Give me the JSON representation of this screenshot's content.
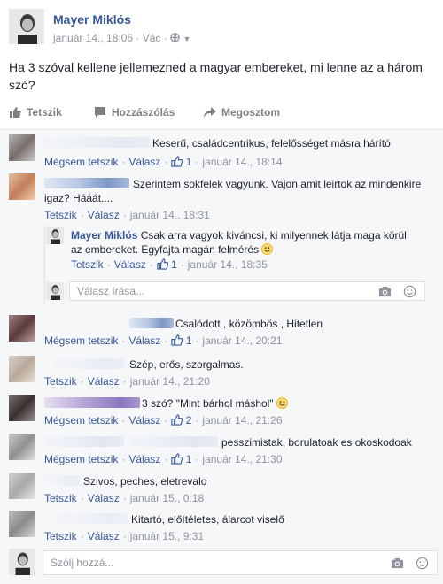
{
  "post": {
    "author": "Mayer Miklós",
    "date": "január 14., 18:06",
    "location": "Vác",
    "text": "Ha 3 szóval kellene jellemezned a magyar embereket, mi lenne az a három szó?",
    "actions": {
      "like": "Tetszik",
      "comment": "Hozzászólás",
      "share": "Megosztom"
    }
  },
  "comments": [
    {
      "text": "Keserű, családcentrikus, felelősséget másra hárító",
      "like": "Mégsem tetszik",
      "reply": "Válasz",
      "likes": "1",
      "time": "január 14., 18:14"
    },
    {
      "text": "Szerintem sokfelek vagyunk. Vajon amit leirtok az mindenkire",
      "text2": "igaz? Hááát....",
      "like": "Tetszik",
      "reply": "Válasz",
      "likes": "",
      "time": "január 14., 18:31"
    },
    {
      "text": "Csalódott , közömbös , Hitetlen",
      "like": "Mégsem tetszik",
      "reply": "Válasz",
      "likes": "1",
      "time": "január 14., 20:21"
    },
    {
      "text": "Szép, erős, szorgalmas.",
      "like": "Tetszik",
      "reply": "Válasz",
      "likes": "",
      "time": "január 14., 21:20"
    },
    {
      "text": "3 szó? \"Mint bárhol máshol\"",
      "like": "Mégsem tetszik",
      "reply": "Válasz",
      "likes": "2",
      "time": "január 14., 21:26"
    },
    {
      "text": "pesszimistak, borulatoak es okoskodoak",
      "like": "Mégsem tetszik",
      "reply": "Válasz",
      "likes": "1",
      "time": "január 14., 21:30"
    },
    {
      "text": "Szivos, peches, eletrevalo",
      "like": "Tetszik",
      "reply": "Válasz",
      "likes": "",
      "time": "január 15., 0:18"
    },
    {
      "text": "Kitartó, előítéletes, álarcot viselő",
      "like": "Tetszik",
      "reply": "Válasz",
      "likes": "",
      "time": "január 15., 9:31"
    }
  ],
  "reply_thread": {
    "author": "Mayer Miklós",
    "text": "Csak arra vagyok kiváncsi, ki milyennek látja maga körül",
    "text2": "az embereket. Egyfajta magán felmérés",
    "like": "Tetszik",
    "reply": "Válasz",
    "likes": "1",
    "time": "január 14., 18:35",
    "placeholder": "Válasz írása..."
  },
  "composer": {
    "placeholder": "Szólj hozzá..."
  },
  "colors": {
    "link": "#365899",
    "meta": "#90949c",
    "bg": "#f6f7f9"
  }
}
